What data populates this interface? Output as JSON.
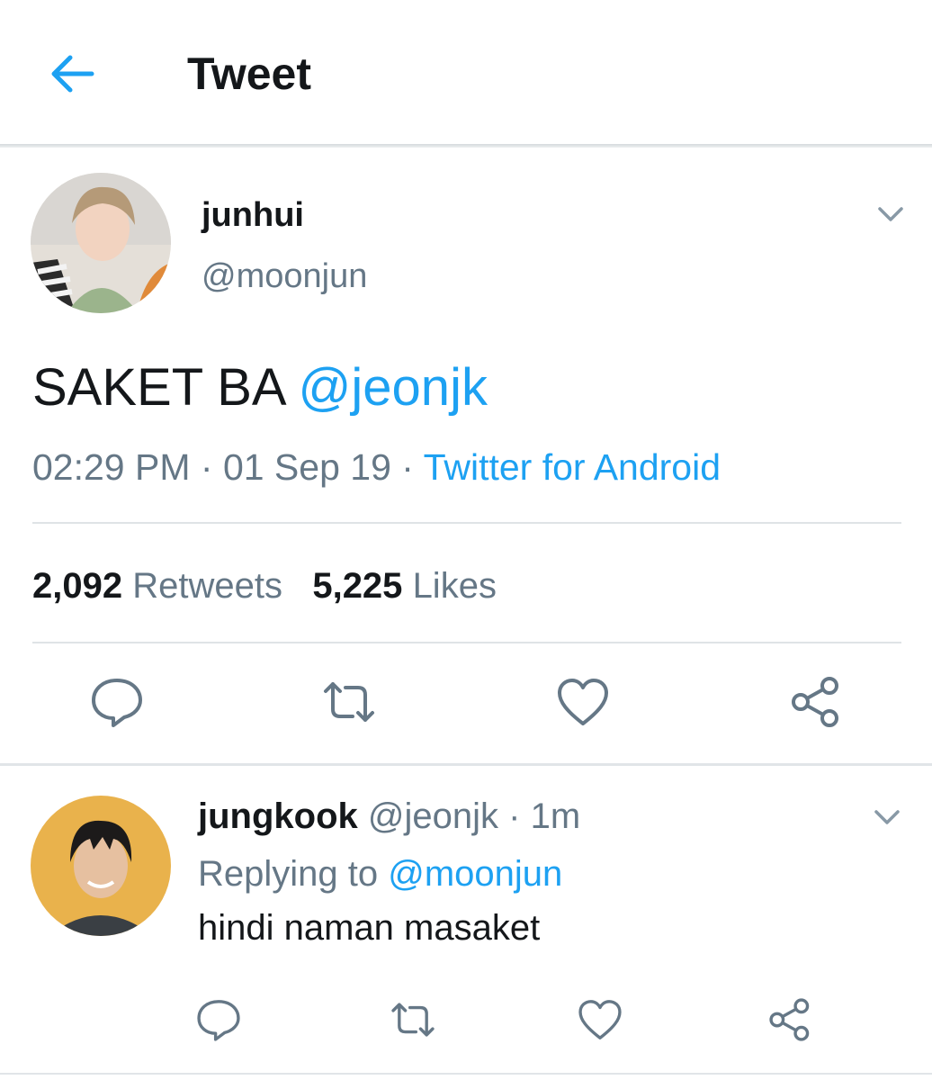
{
  "header": {
    "title": "Tweet"
  },
  "tweet": {
    "author_name": "junhui",
    "author_handle": "@moonjun",
    "text_prefix": "SAKET BA ",
    "text_mention": "@jeonjk",
    "time": "02:29 PM",
    "date": "01 Sep 19",
    "source": "Twitter for Android",
    "retweets_count": "2,092",
    "retweets_label": "Retweets",
    "likes_count": "5,225",
    "likes_label": "Likes"
  },
  "reply": {
    "author_name": "jungkook",
    "author_handle": "@jeonjk",
    "time": "1m",
    "replying_label": "Replying to",
    "replying_to": "@moonjun",
    "text": "hindi naman masaket"
  },
  "colors": {
    "accent": "#1da1f2",
    "muted": "#657786",
    "text": "#14171a"
  },
  "icons": [
    "back-arrow-icon",
    "chevron-down-icon",
    "reply-icon",
    "retweet-icon",
    "like-icon",
    "share-icon"
  ]
}
